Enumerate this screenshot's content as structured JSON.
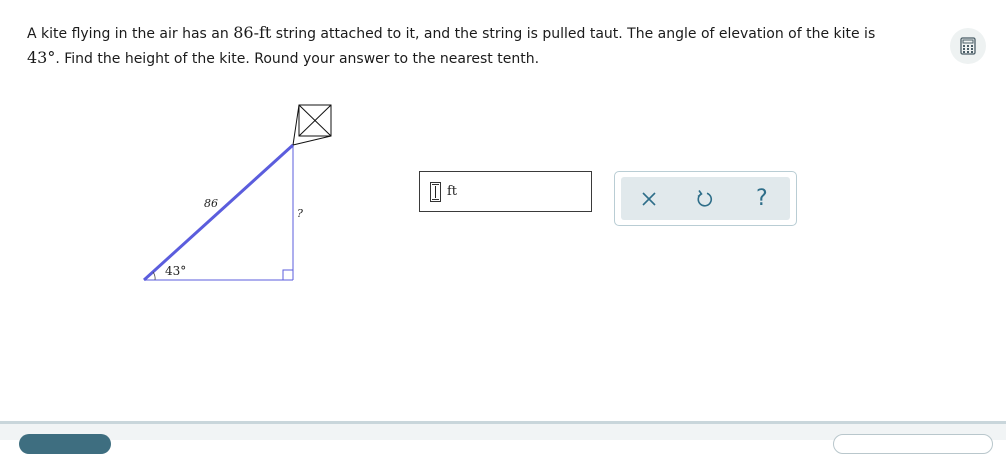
{
  "problem": {
    "text_part1": "A kite flying in the air has an ",
    "string_length": "86",
    "unit_ft": "-ft",
    "text_part2": " string attached to it, and the string is pulled taut. The angle of elevation of the kite is",
    "angle": "43°",
    "text_part3": ". Find the height of the kite. Round your answer to the nearest tenth."
  },
  "figure": {
    "hypotenuse_label": "86",
    "height_label": "?",
    "angle_label": "43°"
  },
  "answer": {
    "value": "",
    "unit": "ft"
  },
  "tools": {
    "clear_symbol": "×",
    "undo_symbol": "↺",
    "help_symbol": "?"
  },
  "icons": {
    "calculator": "calculator-icon",
    "clear": "close-icon",
    "undo": "undo-icon",
    "help": "help-icon"
  },
  "colors": {
    "string_line": "#5b5ddd",
    "height_line": "#5b5ddd",
    "tool_accent": "#2e6e89"
  }
}
